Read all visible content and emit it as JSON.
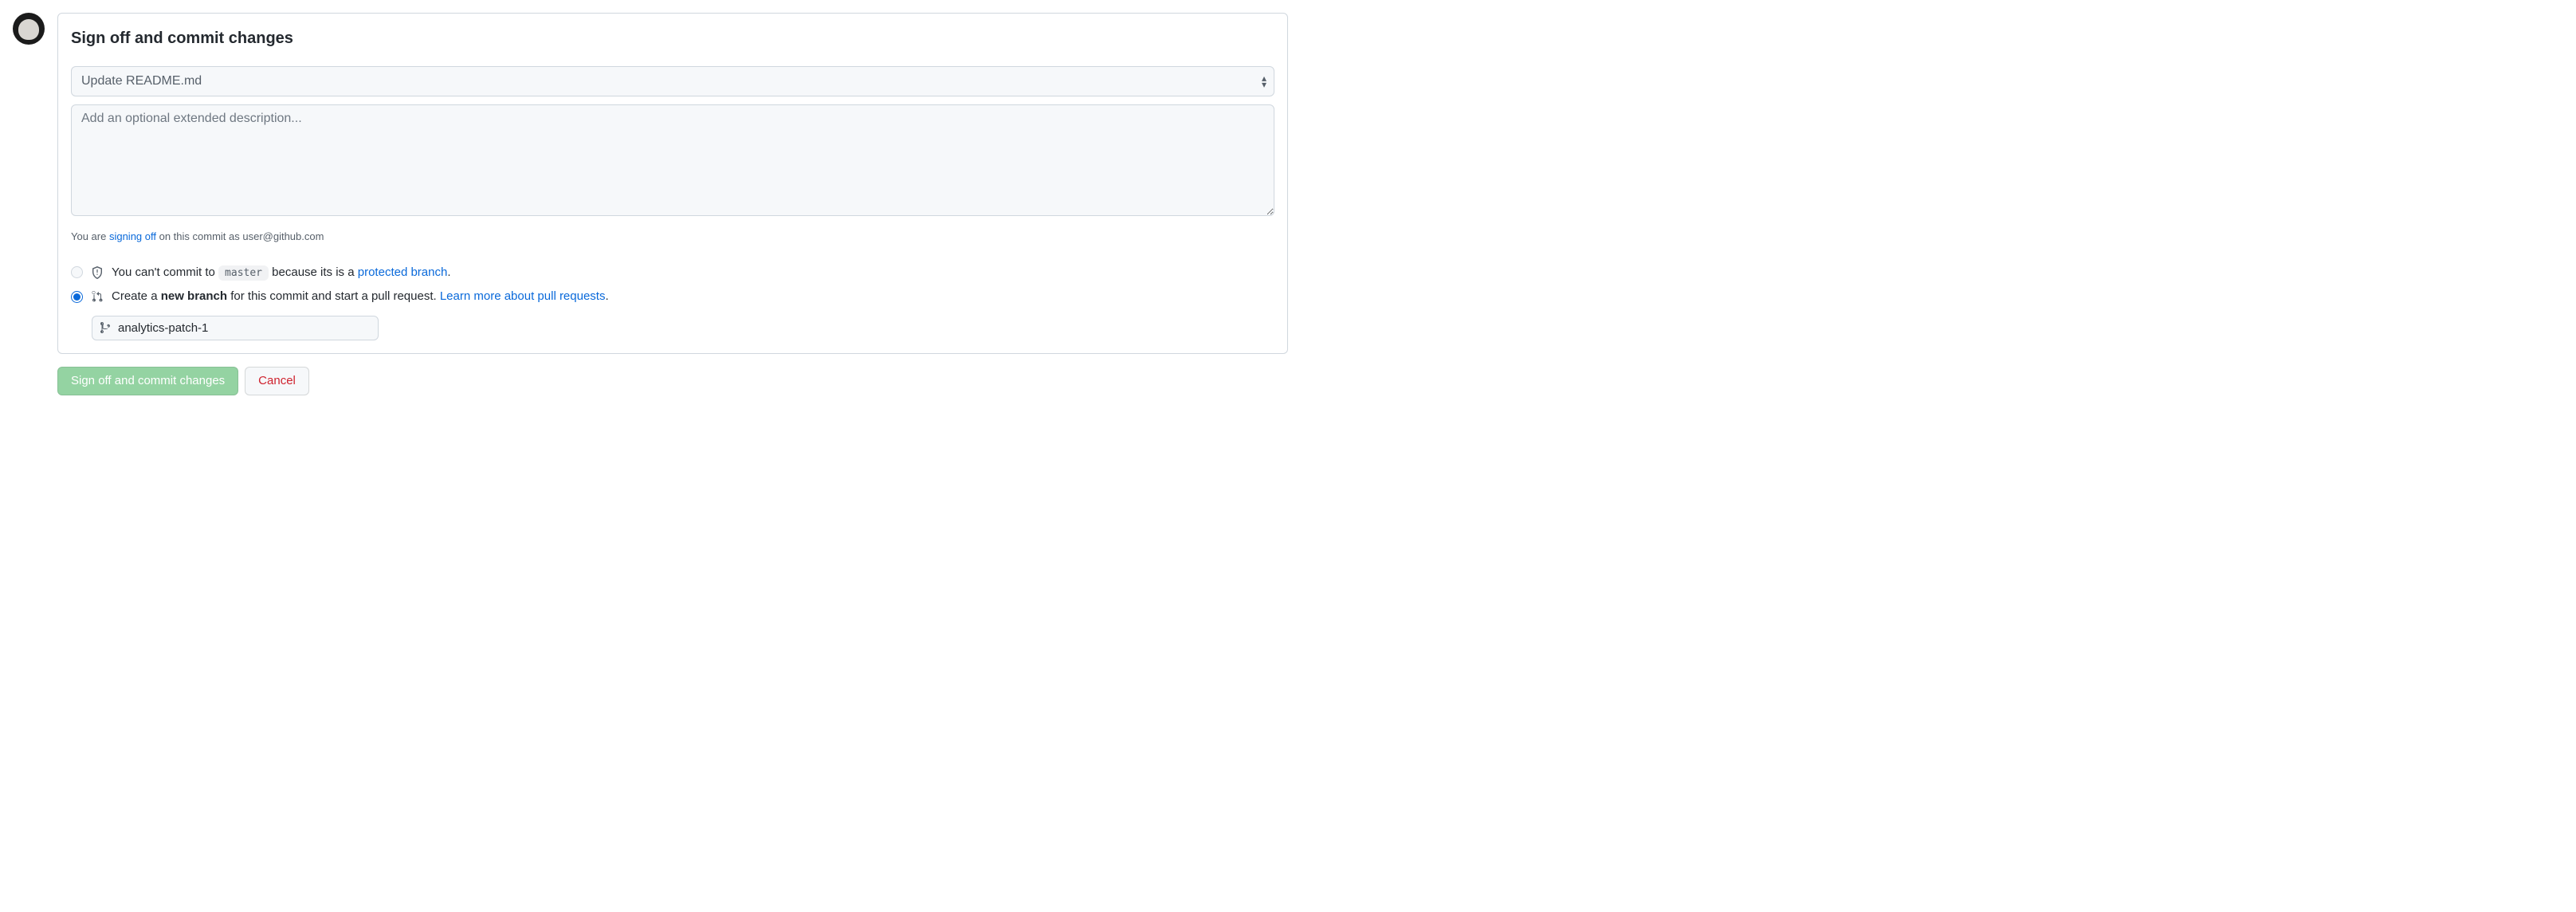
{
  "header": {
    "title": "Sign off and commit changes"
  },
  "commit": {
    "summary_value": "Update README.md",
    "description_placeholder": "Add an optional extended description..."
  },
  "signoff": {
    "prefix": "You are ",
    "link_text": "signing off",
    "middle": " on this commit as ",
    "identity": "user@github.com"
  },
  "options": {
    "direct": {
      "prefix": "You can't commit to ",
      "branch": "master",
      "middle": " because its is a ",
      "link_text": "protected branch",
      "suffix": "."
    },
    "new_branch": {
      "prefix": "Create a ",
      "bold": "new branch",
      "middle": " for this commit and start a pull request. ",
      "link_text": "Learn more about pull requests",
      "suffix": "."
    },
    "branch_name_value": "analytics-patch-1"
  },
  "buttons": {
    "commit": "Sign off and commit changes",
    "cancel": "Cancel"
  }
}
